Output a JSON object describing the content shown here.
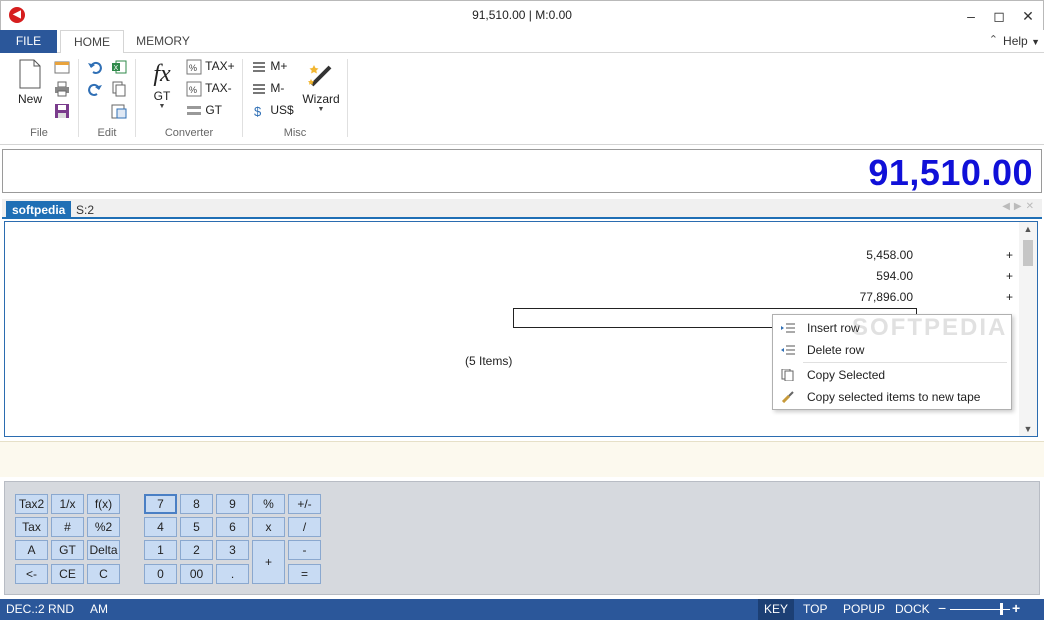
{
  "window": {
    "title": "91,510.00 | M:0.00"
  },
  "tabs": {
    "file": "FILE",
    "home": "HOME",
    "memory": "MEMORY",
    "help": "Help"
  },
  "ribbon": {
    "file": {
      "label": "File",
      "new": "New"
    },
    "edit": {
      "label": "Edit"
    },
    "converter": {
      "label": "Converter",
      "gt_big": "GT",
      "tax_plus": "TAX+",
      "tax_minus": "TAX-",
      "gt_small": "GT"
    },
    "misc": {
      "label": "Misc",
      "m_plus": "M+",
      "m_minus": "M-",
      "usd": "US$",
      "wizard": "Wizard"
    }
  },
  "display": {
    "value": "91,510.00"
  },
  "tape": {
    "tabs": [
      "softpedia",
      "S:2"
    ],
    "rows": [
      {
        "value": "5,458.00",
        "op": "+"
      },
      {
        "value": "594.00",
        "op": "+"
      },
      {
        "value": "77,896.00",
        "op": "+"
      }
    ],
    "items_count": "(5 Items)"
  },
  "context_menu": {
    "items": [
      "Insert row",
      "Delete row",
      "Copy Selected",
      "Copy selected items to new tape"
    ]
  },
  "watermark": "SOFTPEDIA",
  "keypad": {
    "left": [
      "Tax2",
      "1/x",
      "f(x)",
      "Tax",
      "#",
      "%2",
      "A",
      "GT",
      "Delta",
      "<-",
      "CE",
      "C"
    ],
    "right": [
      "7",
      "8",
      "9",
      "%",
      "+/-",
      "4",
      "5",
      "6",
      "x",
      "/",
      "1",
      "2",
      "3",
      "+",
      "-",
      "0",
      "00",
      ".",
      "="
    ]
  },
  "status": {
    "dec": "DEC.:2",
    "rnd": "RND",
    "am": "AM",
    "key": "KEY",
    "top": "TOP",
    "popup": "POPUP",
    "dock": "DOCK",
    "zoom_minus": "−",
    "zoom_plus": "+"
  },
  "colors": {
    "accent": "#2b579a",
    "display_text": "#1010d8",
    "tape_tab": "#1f6fb5",
    "key_bg": "#c8dbf3"
  }
}
